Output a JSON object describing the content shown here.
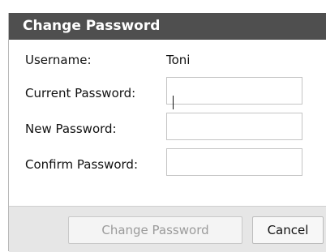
{
  "dialog": {
    "title": "Change Password",
    "username_label": "Username:",
    "username_value": "Toni",
    "current_password_label": "Current Password:",
    "current_password_value": "",
    "new_password_label": "New Password:",
    "new_password_value": "",
    "confirm_password_label": "Confirm Password:",
    "confirm_password_value": "",
    "change_button_label": "Change Password",
    "cancel_button_label": "Cancel"
  },
  "colors": {
    "title_bar": "#4f4f4f",
    "footer": "#e6e6e6",
    "disabled_text": "#9b9b9b"
  }
}
